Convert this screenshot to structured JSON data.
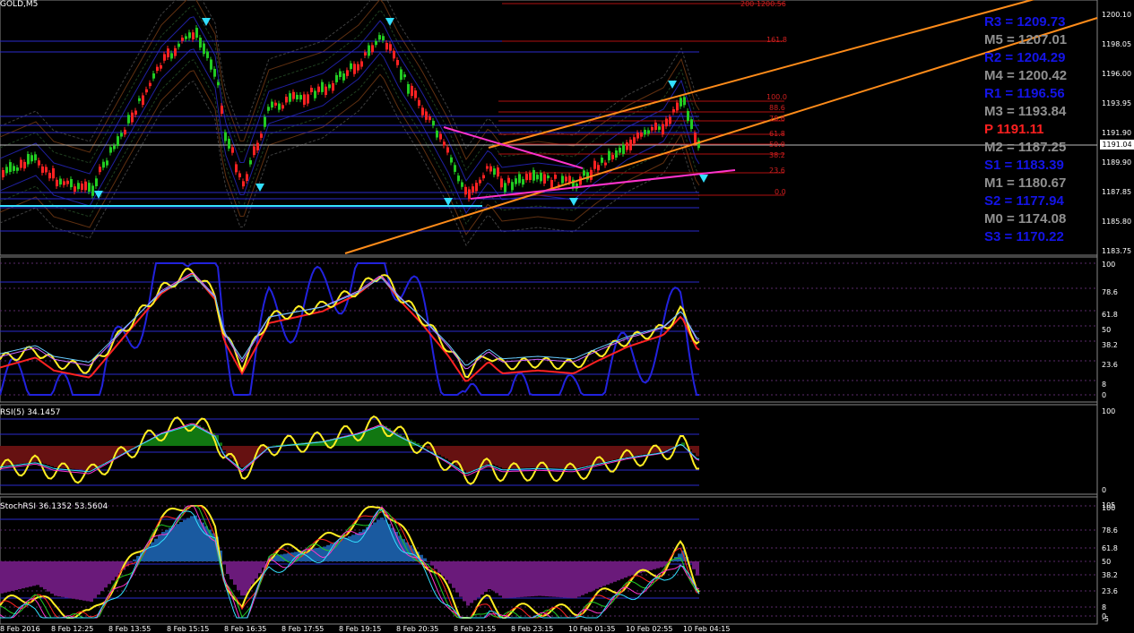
{
  "title": "GOLD,M5",
  "price_axis": [
    "1200.10",
    "1198.05",
    "1196.00",
    "1193.95",
    "1191.90",
    "1189.90",
    "1187.85",
    "1185.80",
    "1183.75"
  ],
  "current_price": "1191.04",
  "fib_levels": [
    "200 1200.56",
    "161.8",
    "100.0",
    "88.6",
    "78.6",
    "61.8",
    "50.0",
    "38.2",
    "23.6",
    "0.0"
  ],
  "pivots": [
    {
      "label": "R3 = 1209.73",
      "kind": "r"
    },
    {
      "label": "M5 = 1207.01",
      "kind": "m"
    },
    {
      "label": "R2 = 1204.29",
      "kind": "r"
    },
    {
      "label": "M4 = 1200.42",
      "kind": "m"
    },
    {
      "label": "R1 = 1196.56",
      "kind": "r"
    },
    {
      "label": "M3 = 1193.84",
      "kind": "m"
    },
    {
      "label": "P   1191.11",
      "kind": "p"
    },
    {
      "label": "M2 = 1187.25",
      "kind": "m"
    },
    {
      "label": "S1 = 1183.39",
      "kind": "s"
    },
    {
      "label": "M1 = 1180.67",
      "kind": "m"
    },
    {
      "label": "S2 = 1177.94",
      "kind": "s"
    },
    {
      "label": "M0 = 1174.08",
      "kind": "m"
    },
    {
      "label": "S3 = 1170.22",
      "kind": "s"
    }
  ],
  "panel1_axis": [
    "100",
    "78.6",
    "61.8",
    "50",
    "38.2",
    "23.6",
    "8",
    "0"
  ],
  "rsi_title": "RSI(5) 34.1457",
  "rsi_axis": [
    "100",
    "0"
  ],
  "stoch_title": "StochRSI 36.1352 53.5604",
  "stoch_axis": [
    "105",
    "100",
    "78.6",
    "61.8",
    "50",
    "38.2",
    "23.6",
    "8",
    "0",
    "-5"
  ],
  "time_axis": [
    "8 Feb 2016",
    "8 Feb 12:25",
    "8 Feb 13:55",
    "8 Feb 15:15",
    "8 Feb 16:35",
    "8 Feb 17:55",
    "8 Feb 19:15",
    "8 Feb 20:35",
    "8 Feb 21:55",
    "8 Feb 23:15",
    "10 Feb 01:35",
    "10 Feb 02:55",
    "10 Feb 04:15"
  ],
  "colors": {
    "bull": "#22cc22",
    "bear": "#ff2222",
    "pivot_r": "#1414e6",
    "pivot_m": "#909090",
    "pivot_p": "#ff2020",
    "trend": "#ff8c1a",
    "magenta": "#ff33cc",
    "cyan": "#33e0ff"
  }
}
